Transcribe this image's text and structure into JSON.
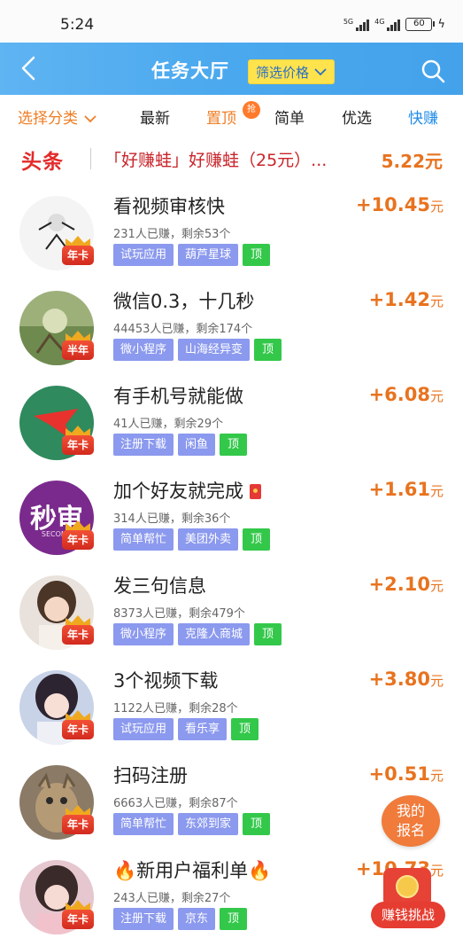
{
  "status_bar": {
    "time": "5:24",
    "signal1_label": "5G",
    "signal2_label": "4G",
    "battery": "60"
  },
  "header": {
    "title": "任务大厅",
    "filter_label": "筛选价格"
  },
  "tabs": {
    "category": "选择分类",
    "latest": "最新",
    "top": "置顶",
    "top_badge": "抢",
    "simple": "简单",
    "preferred": "优选",
    "fast": "快赚"
  },
  "headline": {
    "tag": "头条",
    "text": "「好赚蛙」好赚蛙（25元）...",
    "price": "5.22元"
  },
  "tasks": [
    {
      "title": "看视频审核快",
      "meta": "231人已赚，剩余53个",
      "tags": [
        "试玩应用",
        "葫芦星球",
        "顶"
      ],
      "price": "+10.45",
      "unit": "元",
      "badge": "年卡"
    },
    {
      "title": "微信0.3，十几秒",
      "meta": "44453人已赚，剩余174个",
      "tags": [
        "微小程序",
        "山海经异变",
        "顶"
      ],
      "price": "+1.42",
      "unit": "元",
      "badge": "半年"
    },
    {
      "title": "有手机号就能做",
      "meta": "41人已赚，剩余29个",
      "tags": [
        "注册下载",
        "闲鱼",
        "顶"
      ],
      "price": "+6.08",
      "unit": "元",
      "badge": "年卡"
    },
    {
      "title": "加个好友就完成",
      "meta": "314人已赚，剩余36个",
      "tags": [
        "简单帮忙",
        "美团外卖",
        "顶"
      ],
      "price": "+1.61",
      "unit": "元",
      "badge": "年卡",
      "avatar_text": "秒审",
      "avatar_sub": "SECOND"
    },
    {
      "title": "发三句信息",
      "meta": "8373人已赚，剩余479个",
      "tags": [
        "微小程序",
        "克隆人商城",
        "顶"
      ],
      "price": "+2.10",
      "unit": "元",
      "badge": "年卡"
    },
    {
      "title": "3个视频下载",
      "meta": "1122人已赚，剩余28个",
      "tags": [
        "试玩应用",
        "看乐享",
        "顶"
      ],
      "price": "+3.80",
      "unit": "元",
      "badge": "年卡"
    },
    {
      "title": "扫码注册",
      "meta": "6663人已赚，剩余87个",
      "tags": [
        "简单帮忙",
        "东郊到家",
        "顶"
      ],
      "price": "+0.51",
      "unit": "元",
      "badge": "年卡"
    },
    {
      "title": "🔥新用户福利单🔥",
      "meta": "243人已赚，剩余27个",
      "tags": [
        "注册下载",
        "京东",
        "顶"
      ],
      "price": "+10.73",
      "unit": "元",
      "badge": "年卡"
    }
  ],
  "floating": {
    "mine_line1": "我的",
    "mine_line2": "报名",
    "challenge": "赚钱挑战"
  },
  "colors": {
    "header_blue": "#4aa8ee",
    "price_orange": "#e8731f",
    "tag_purple": "#8b99ee",
    "tag_green": "#33c84a",
    "headline_red": "#e32a2a"
  }
}
